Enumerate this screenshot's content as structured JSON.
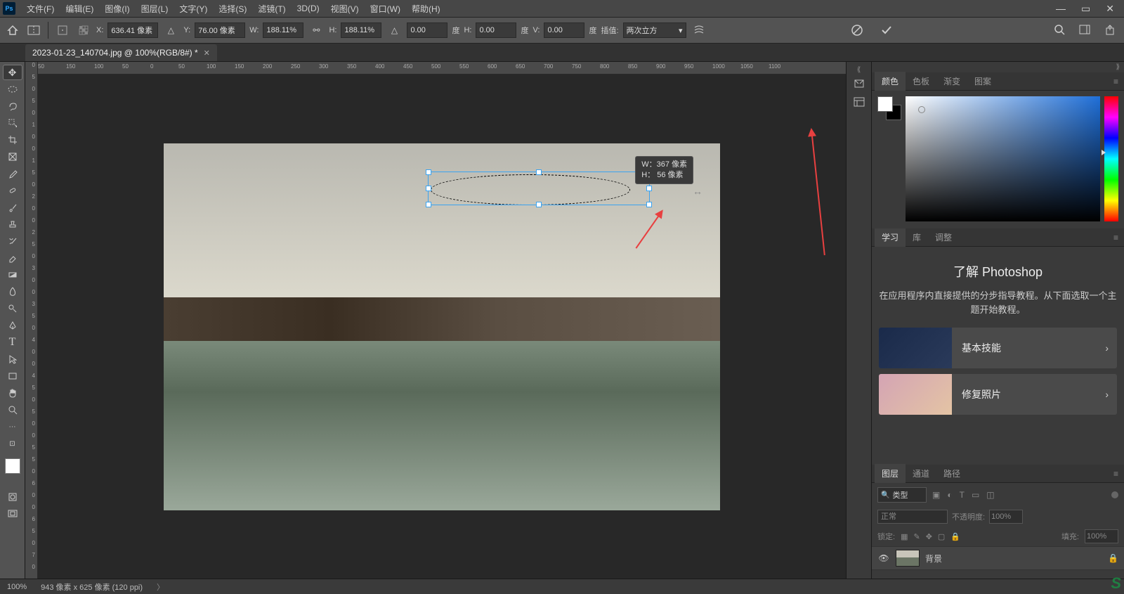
{
  "menubar": [
    "文件(F)",
    "编辑(E)",
    "图像(I)",
    "图层(L)",
    "文字(Y)",
    "选择(S)",
    "滤镜(T)",
    "3D(D)",
    "视图(V)",
    "窗口(W)",
    "帮助(H)"
  ],
  "options": {
    "x_label": "X:",
    "x": "636.41 像素",
    "y_label": "Y:",
    "y": "76.00 像素",
    "w_label": "W:",
    "w": "188.11%",
    "h_label": "H:",
    "h": "188.11%",
    "angle_icon": "△",
    "angle": "0.00",
    "angle_unit": "度",
    "skew_h_label": "H:",
    "skew_h": "0.00",
    "skew_h_unit": "度",
    "skew_v_label": "V:",
    "skew_v": "0.00",
    "skew_v_unit": "度",
    "interp_label": "插值:",
    "interp": "两次立方"
  },
  "tab": {
    "title": "2023-01-23_140704.jpg @ 100%(RGB/8#) *"
  },
  "hruler_ticks": [
    "50",
    "150",
    "100",
    "50",
    "0",
    "50",
    "100",
    "150",
    "200",
    "250",
    "300",
    "350",
    "400",
    "450",
    "500",
    "550",
    "600",
    "650",
    "700",
    "750",
    "800",
    "850",
    "900",
    "950",
    "1000",
    "1050",
    "1100"
  ],
  "vruler_ticks": [
    "0",
    "5",
    "0",
    "5",
    "0",
    "1",
    "0",
    "0",
    "1",
    "5",
    "0",
    "2",
    "0",
    "0",
    "2",
    "5",
    "0",
    "3",
    "0",
    "0",
    "3",
    "5",
    "0",
    "4",
    "0",
    "0",
    "4",
    "5",
    "0",
    "5",
    "0",
    "0",
    "5",
    "5",
    "0",
    "6",
    "0",
    "0",
    "6",
    "5",
    "0",
    "7",
    "0"
  ],
  "tooltip": {
    "w": "W：367 像素",
    "h": "H： 56 像素"
  },
  "color_tabs": [
    "颜色",
    "色板",
    "渐变",
    "图案"
  ],
  "learn_tabs": [
    "学习",
    "库",
    "调整"
  ],
  "learn": {
    "title": "了解 Photoshop",
    "desc": "在应用程序内直接提供的分步指导教程。从下面选取一个主题开始教程。",
    "cards": [
      "基本技能",
      "修复照片"
    ]
  },
  "layer_tabs": [
    "图层",
    "通道",
    "路径"
  ],
  "layers": {
    "filter_kind": "类型",
    "blend_mode": "正常",
    "opacity_label": "不透明度:",
    "opacity": "100%",
    "lock_label": "锁定:",
    "fill_label": "填充:",
    "fill": "100%",
    "background_name": "背景"
  },
  "status": {
    "zoom": "100%",
    "doc": "943 像素 x 625 像素 (120 ppi)"
  }
}
